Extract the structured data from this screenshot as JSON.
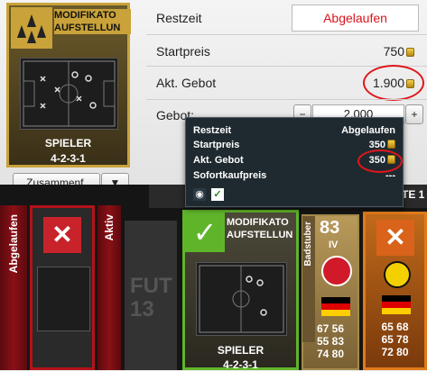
{
  "left_card": {
    "title_line1": "MODIFIKATO",
    "title_line2": "AUFSTELLUN",
    "type_label": "SPIELER",
    "formation": "4-2-3-1"
  },
  "summary_dropdown": {
    "label": "Zusammenf."
  },
  "details": {
    "restzeit_label": "Restzeit",
    "restzeit_value": "Abgelaufen",
    "startpreis_label": "Startpreis",
    "startpreis_value": "750",
    "gebot_label": "Akt. Gebot",
    "gebot_value": "1.900",
    "bid_label": "Gebot:",
    "bid_value": "2.000",
    "minus": "−",
    "plus": "+"
  },
  "popup": {
    "rows": [
      {
        "label": "Restzeit",
        "value": "Abgelaufen"
      },
      {
        "label": "Startpreis",
        "value": "350"
      },
      {
        "label": "Akt. Gebot",
        "value": "350"
      },
      {
        "label": "Sofortkaufpreis",
        "value": "---"
      }
    ]
  },
  "tray": {
    "expired_label": "Abgelaufen",
    "active_label": "Aktiv",
    "fut_logo_line1": "FUT",
    "fut_logo_line2": "13",
    "right_edge_text": "TE 1",
    "center_card": {
      "title_line1": "MODIFIKATO",
      "title_line2": "AUFSTELLUN",
      "type_label": "SPIELER",
      "formation": "4-2-3-1"
    },
    "player_card": {
      "rating": "83",
      "position": "IV",
      "name": "Badstuber",
      "stats": [
        {
          "a": "67",
          "b": "56"
        },
        {
          "a": "55",
          "b": "83"
        },
        {
          "a": "74",
          "b": "80"
        }
      ]
    },
    "right_card": {
      "stats": [
        {
          "a": "65",
          "b": "68"
        },
        {
          "a": "65",
          "b": "78"
        },
        {
          "a": "72",
          "b": "80"
        }
      ]
    }
  },
  "colors": {
    "expired_red": "#d9141c",
    "gold_border": "#c9a23a",
    "green_border": "#5fb52a",
    "highlight_ellipse": "#e0161b"
  }
}
